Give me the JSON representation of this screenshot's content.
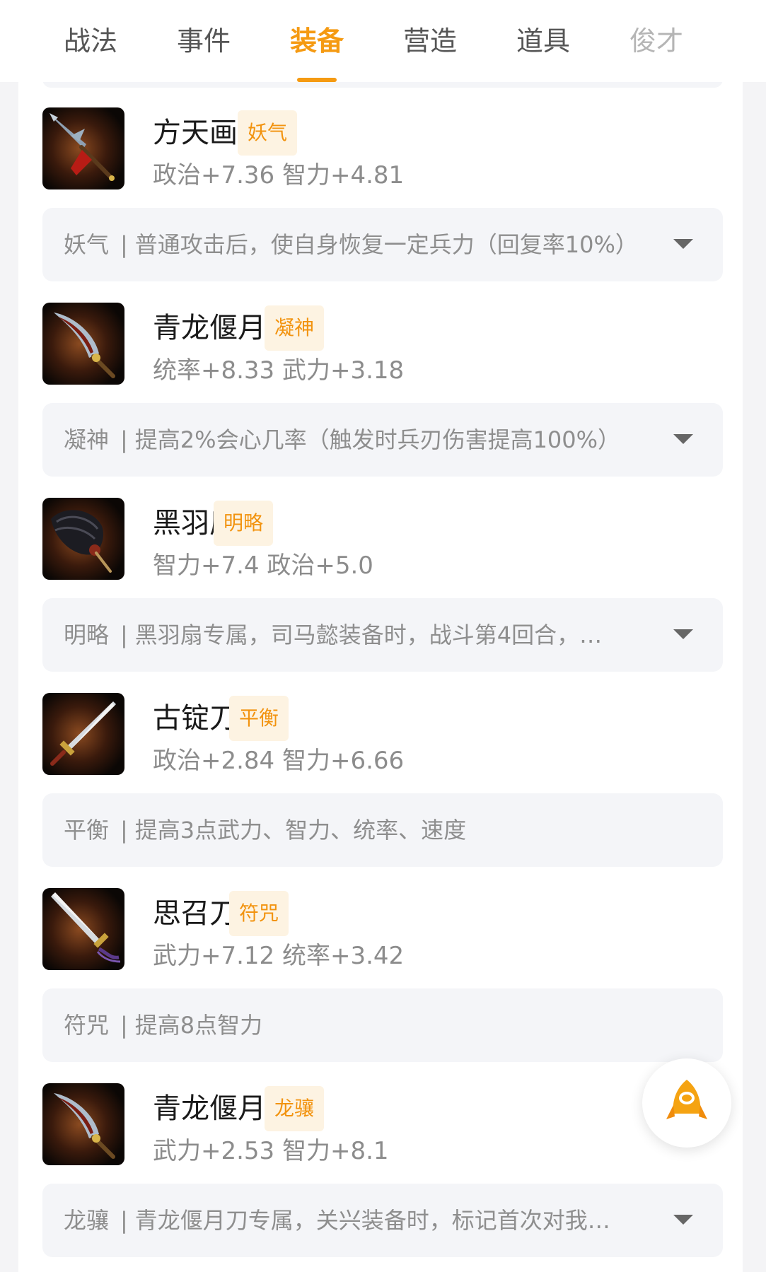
{
  "tabs": [
    {
      "label": "战法",
      "active": false
    },
    {
      "label": "事件",
      "active": false
    },
    {
      "label": "装备",
      "active": true
    },
    {
      "label": "营造",
      "active": false
    },
    {
      "label": "道具",
      "active": false
    },
    {
      "label": "俊才",
      "active": false
    }
  ],
  "accent_color": "#f59a12",
  "items": [
    {
      "name": "方天画戟",
      "tag": "妖气",
      "stats": "政治+7.36 智力+4.81",
      "desc_label": "妖气",
      "desc_text": "普通攻击后，使自身恢复一定兵力（回复率10%）",
      "expandable": true,
      "icon": "halberd-icon"
    },
    {
      "name": "青龙偃月刀",
      "tag": "凝神",
      "stats": "统率+8.33 武力+3.18",
      "desc_label": "凝神",
      "desc_text": "提高2%会心几率（触发时兵刃伤害提高100%）",
      "expandable": true,
      "icon": "glaive-icon"
    },
    {
      "name": "黑羽扇",
      "tag": "明略",
      "stats": "智力+7.4 政治+5.0",
      "desc_label": "明略",
      "desc_text": "黑羽扇专属，司马懿装备时，战斗第4回合，…",
      "expandable": true,
      "icon": "feather-fan-icon"
    },
    {
      "name": "古锭刀",
      "tag": "平衡",
      "stats": "政治+2.84 智力+6.66",
      "desc_label": "平衡",
      "desc_text": "提高3点武力、智力、统率、速度",
      "expandable": false,
      "icon": "sword-icon"
    },
    {
      "name": "思召刀",
      "tag": "符咒",
      "stats": "武力+7.12 统率+3.42",
      "desc_label": "符咒",
      "desc_text": "提高8点智力",
      "expandable": false,
      "icon": "sword-icon"
    },
    {
      "name": "青龙偃月刀",
      "tag": "龙骧",
      "stats": "武力+2.53 智力+8.1",
      "desc_label": "龙骧",
      "desc_text": "青龙偃月刀专属，关兴装备时，标记首次对我…",
      "expandable": true,
      "icon": "glaive-icon"
    }
  ],
  "fab": {
    "icon": "rocket-icon"
  }
}
